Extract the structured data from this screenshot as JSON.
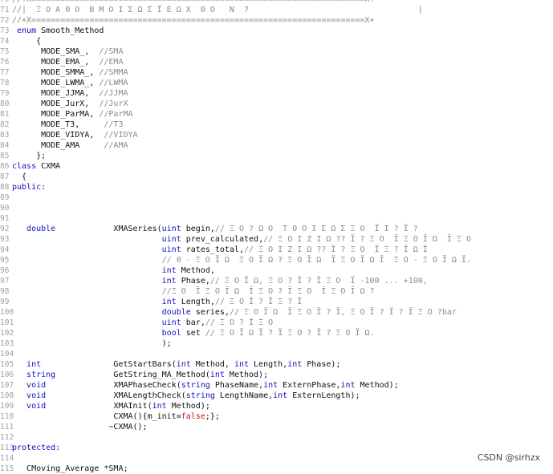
{
  "editor": {
    "lines": [
      {
        "n": "70",
        "segs": [
          {
            "t": "//+X=====================================================================X+",
            "c": "cm"
          }
        ]
      },
      {
        "n": "71",
        "segs": [
          {
            "t": "//|  Ξ Ο Α Θ Ο  Β Μ Ο Ι Σ Ω Σ Ϊ Ε Ω Χ  Θ Ο   Ν  ?                                   |",
            "c": "cm"
          }
        ]
      },
      {
        "n": "72",
        "segs": [
          {
            "t": "//+X=====================================================================X+",
            "c": "cm"
          }
        ]
      },
      {
        "n": "73",
        "segs": [
          {
            "t": " enum ",
            "c": "kw"
          },
          {
            "t": "Smooth_Method",
            "c": ""
          }
        ]
      },
      {
        "n": "74",
        "segs": [
          {
            "t": "     {",
            "c": ""
          }
        ]
      },
      {
        "n": "75",
        "segs": [
          {
            "t": "      MODE_SMA_,  ",
            "c": ""
          },
          {
            "t": "//SMA",
            "c": "cm"
          }
        ]
      },
      {
        "n": "76",
        "segs": [
          {
            "t": "      MODE_EMA_,  ",
            "c": ""
          },
          {
            "t": "//EMA",
            "c": "cm"
          }
        ]
      },
      {
        "n": "77",
        "segs": [
          {
            "t": "      MODE_SMMA_, ",
            "c": ""
          },
          {
            "t": "//SMMA",
            "c": "cm"
          }
        ]
      },
      {
        "n": "78",
        "segs": [
          {
            "t": "      MODE_LWMA_, ",
            "c": ""
          },
          {
            "t": "//LWMA",
            "c": "cm"
          }
        ]
      },
      {
        "n": "79",
        "segs": [
          {
            "t": "      MODE_JJMA,  ",
            "c": ""
          },
          {
            "t": "//JJMA",
            "c": "cm"
          }
        ]
      },
      {
        "n": "80",
        "segs": [
          {
            "t": "      MODE_JurX,  ",
            "c": ""
          },
          {
            "t": "//JurX",
            "c": "cm"
          }
        ]
      },
      {
        "n": "81",
        "segs": [
          {
            "t": "      MODE_ParMA, ",
            "c": ""
          },
          {
            "t": "//ParMA",
            "c": "cm"
          }
        ]
      },
      {
        "n": "82",
        "segs": [
          {
            "t": "      MODE_T3,     ",
            "c": ""
          },
          {
            "t": "//T3",
            "c": "cm"
          }
        ]
      },
      {
        "n": "83",
        "segs": [
          {
            "t": "      MODE_VIDYA,  ",
            "c": ""
          },
          {
            "t": "//VIDYA",
            "c": "cm"
          }
        ]
      },
      {
        "n": "84",
        "segs": [
          {
            "t": "      MODE_AMA     ",
            "c": ""
          },
          {
            "t": "//AMA",
            "c": "cm"
          }
        ]
      },
      {
        "n": "85",
        "segs": [
          {
            "t": "     };",
            "c": ""
          }
        ]
      },
      {
        "n": "86",
        "segs": [
          {
            "t": "class ",
            "c": "kw"
          },
          {
            "t": "CXMA",
            "c": ""
          }
        ]
      },
      {
        "n": "87",
        "segs": [
          {
            "t": "  {",
            "c": ""
          }
        ]
      },
      {
        "n": "88",
        "segs": [
          {
            "t": "public:",
            "c": "kw"
          }
        ]
      },
      {
        "n": "89",
        "segs": []
      },
      {
        "n": "90",
        "segs": []
      },
      {
        "n": "91",
        "segs": []
      },
      {
        "n": "92",
        "segs": [
          {
            "t": "   double",
            "c": "kw"
          },
          {
            "t": "            XMASeries(",
            "c": ""
          },
          {
            "t": "uint",
            "c": "kw"
          },
          {
            "t": " begin,",
            "c": ""
          },
          {
            "t": "// Ξ Ο ? Ω Ο  Τ Θ Ο Ι Σ Ω Σ Ξ Ο  Ϊ Ι ? Ϊ ?",
            "c": "cm"
          }
        ]
      },
      {
        "n": "93",
        "segs": [
          {
            "t": "                               ",
            "c": ""
          },
          {
            "t": "uint",
            "c": "kw"
          },
          {
            "t": " prev_calculated,",
            "c": ""
          },
          {
            "t": "// Ξ Ο Ι Ζ Ι Ω ?? Ϊ ? Ξ Ο  Ϊ Ξ Ο Ϊ Ω  Ϊ Ξ Ο",
            "c": "cm"
          }
        ]
      },
      {
        "n": "94",
        "segs": [
          {
            "t": "                               ",
            "c": ""
          },
          {
            "t": "uint",
            "c": "kw"
          },
          {
            "t": " rates_total,",
            "c": ""
          },
          {
            "t": "// Ξ Ο Ι Ζ Ι Ω ?? Ϊ ? Ξ Ο  Ϊ Ξ ? Ϊ Ω Ϊ",
            "c": "cm"
          }
        ]
      },
      {
        "n": "95",
        "segs": [
          {
            "t": "                               ",
            "c": ""
          },
          {
            "t": "// 0 - Ξ Ο Ϊ Ω  Ξ Ο Ϊ Ω ? Ξ Ο Ϊ Ω  Ϊ Ξ Ο Ϊ Ω Ϊ  Ξ Ο - Ξ Ο Ϊ Ω Ϊ.",
            "c": "cm"
          }
        ]
      },
      {
        "n": "96",
        "segs": [
          {
            "t": "                               ",
            "c": ""
          },
          {
            "t": "int",
            "c": "kw"
          },
          {
            "t": " Method,",
            "c": ""
          }
        ]
      },
      {
        "n": "97",
        "segs": [
          {
            "t": "                               ",
            "c": ""
          },
          {
            "t": "int",
            "c": "kw"
          },
          {
            "t": " Phase,",
            "c": ""
          },
          {
            "t": "// Ξ Ο Ϊ Ω, Ξ Ο ? Ϊ ? Ϊ Ξ Ο  Ϊ -100 ... +100,",
            "c": "cm"
          }
        ]
      },
      {
        "n": "98",
        "segs": [
          {
            "t": "                               ",
            "c": ""
          },
          {
            "t": "//Ξ Ο  Ϊ Ξ Ο Ϊ Ω  Ϊ Ξ Ο ? Ϊ Ξ Ο  Ϊ Ξ Ο Ϊ Ω ?",
            "c": "cm"
          }
        ]
      },
      {
        "n": "99",
        "segs": [
          {
            "t": "                               ",
            "c": ""
          },
          {
            "t": "int",
            "c": "kw"
          },
          {
            "t": " Length,",
            "c": ""
          },
          {
            "t": "// Ξ Ο Ϊ ? Ϊ Ξ ? Ϊ",
            "c": "cm"
          }
        ]
      },
      {
        "n": "100",
        "segs": [
          {
            "t": "                               ",
            "c": ""
          },
          {
            "t": "double",
            "c": "kw"
          },
          {
            "t": " series,",
            "c": ""
          },
          {
            "t": "// Ξ Ο Ϊ Ω  Ϊ Ξ Ο Ϊ ? Ϊ, Ξ Ο Ϊ ? Ϊ ? Ϊ Ξ Ο ?bar",
            "c": "cm"
          }
        ]
      },
      {
        "n": "101",
        "segs": [
          {
            "t": "                               ",
            "c": ""
          },
          {
            "t": "uint",
            "c": "kw"
          },
          {
            "t": " bar,",
            "c": ""
          },
          {
            "t": "// Ξ Ο ? Ϊ Ξ Ο",
            "c": "cm"
          }
        ]
      },
      {
        "n": "102",
        "segs": [
          {
            "t": "                               ",
            "c": ""
          },
          {
            "t": "bool",
            "c": "kw"
          },
          {
            "t": " set ",
            "c": ""
          },
          {
            "t": "// Ξ Ο Ϊ Ω Ϊ ? Ϊ Ξ Ο ? Ϊ ? Ξ Ο Ϊ Ω.",
            "c": "cm"
          }
        ]
      },
      {
        "n": "103",
        "segs": [
          {
            "t": "                               );",
            "c": ""
          }
        ]
      },
      {
        "n": "104",
        "segs": []
      },
      {
        "n": "105",
        "segs": [
          {
            "t": "   int",
            "c": "kw"
          },
          {
            "t": "               GetStartBars(",
            "c": ""
          },
          {
            "t": "int",
            "c": "kw"
          },
          {
            "t": " Method, ",
            "c": ""
          },
          {
            "t": "int",
            "c": "kw"
          },
          {
            "t": " Length,",
            "c": ""
          },
          {
            "t": "int",
            "c": "kw"
          },
          {
            "t": " Phase);",
            "c": ""
          }
        ]
      },
      {
        "n": "106",
        "segs": [
          {
            "t": "   string",
            "c": "kw"
          },
          {
            "t": "            GetString_MA_Method(",
            "c": ""
          },
          {
            "t": "int",
            "c": "kw"
          },
          {
            "t": " Method);",
            "c": ""
          }
        ]
      },
      {
        "n": "107",
        "segs": [
          {
            "t": "   void",
            "c": "kw"
          },
          {
            "t": "              XMAPhaseCheck(",
            "c": ""
          },
          {
            "t": "string",
            "c": "kw"
          },
          {
            "t": " PhaseName,",
            "c": ""
          },
          {
            "t": "int",
            "c": "kw"
          },
          {
            "t": " ExternPhase,",
            "c": ""
          },
          {
            "t": "int",
            "c": "kw"
          },
          {
            "t": " Method);",
            "c": ""
          }
        ]
      },
      {
        "n": "108",
        "segs": [
          {
            "t": "   void",
            "c": "kw"
          },
          {
            "t": "              XMALengthCheck(",
            "c": ""
          },
          {
            "t": "string",
            "c": "kw"
          },
          {
            "t": " LengthName,",
            "c": ""
          },
          {
            "t": "int",
            "c": "kw"
          },
          {
            "t": " ExternLength);",
            "c": ""
          }
        ]
      },
      {
        "n": "109",
        "segs": [
          {
            "t": "   void",
            "c": "kw"
          },
          {
            "t": "              XMAInit(",
            "c": ""
          },
          {
            "t": "int",
            "c": "kw"
          },
          {
            "t": " Method);",
            "c": ""
          }
        ]
      },
      {
        "n": "110",
        "segs": [
          {
            "t": "                     CXMA(){m_init=",
            "c": ""
          },
          {
            "t": "false",
            "c": "str"
          },
          {
            "t": ";};",
            "c": ""
          }
        ]
      },
      {
        "n": "111",
        "segs": [
          {
            "t": "                    ~CXMA();",
            "c": ""
          }
        ]
      },
      {
        "n": "112",
        "segs": []
      },
      {
        "n": "113",
        "segs": [
          {
            "t": "protected:",
            "c": "kw"
          }
        ]
      },
      {
        "n": "114",
        "segs": []
      },
      {
        "n": "115",
        "segs": [
          {
            "t": "   CMoving_Average *SMA;",
            "c": ""
          }
        ]
      }
    ]
  },
  "watermark": "CSDN @sirhzx"
}
